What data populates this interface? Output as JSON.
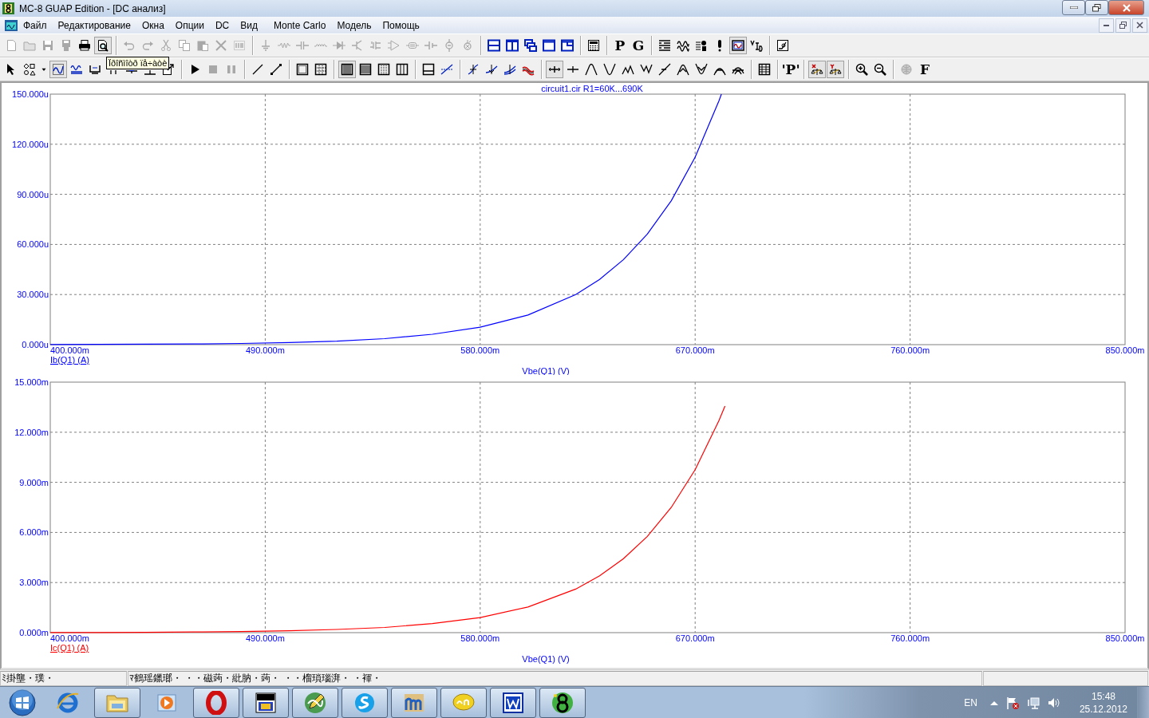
{
  "window": {
    "title": "MC-8 GUAP Edition - [DC анализ]"
  },
  "menu": [
    "Файл",
    "Редактирование",
    "Окна",
    "Опции",
    "DC",
    "Вид",
    "Monte Carlo",
    "Модель",
    "Помощь"
  ],
  "toolbars": [
    {
      "items": [
        {
          "kind": "icon",
          "disabled": true,
          "pressed": false
        },
        {
          "kind": "icon",
          "disabled": true,
          "pressed": false
        },
        {
          "kind": "icon",
          "disabled": true,
          "pressed": false
        },
        {
          "kind": "icon",
          "disabled": true,
          "pressed": false
        },
        {
          "kind": "icon",
          "disabled": false,
          "pressed": false
        },
        {
          "kind": "icon",
          "disabled": false,
          "pressed": true
        },
        {
          "kind": "separator"
        },
        {
          "kind": "icon",
          "disabled": true,
          "pressed": false
        },
        {
          "kind": "icon",
          "disabled": true,
          "pressed": false
        },
        {
          "kind": "icon",
          "disabled": true,
          "pressed": false
        },
        {
          "kind": "icon",
          "disabled": true,
          "pressed": false
        },
        {
          "kind": "icon",
          "disabled": true,
          "pressed": false
        },
        {
          "kind": "icon",
          "disabled": true,
          "pressed": false
        },
        {
          "kind": "icon",
          "disabled": true,
          "pressed": false
        },
        {
          "kind": "separator"
        },
        {
          "kind": "icon",
          "disabled": true,
          "pressed": false
        },
        {
          "kind": "icon",
          "disabled": true,
          "pressed": false
        },
        {
          "kind": "icon",
          "disabled": true,
          "pressed": false
        },
        {
          "kind": "icon",
          "disabled": true,
          "pressed": false
        },
        {
          "kind": "icon",
          "disabled": true,
          "pressed": false
        },
        {
          "kind": "icon",
          "disabled": true,
          "pressed": false
        },
        {
          "kind": "icon",
          "disabled": true,
          "pressed": false
        },
        {
          "kind": "icon",
          "disabled": true,
          "pressed": false
        },
        {
          "kind": "icon",
          "disabled": true,
          "pressed": false
        },
        {
          "kind": "icon",
          "disabled": true,
          "pressed": false
        },
        {
          "kind": "icon",
          "disabled": true,
          "pressed": false
        },
        {
          "kind": "icon",
          "disabled": true,
          "pressed": false
        },
        {
          "kind": "separator"
        },
        {
          "kind": "icon",
          "disabled": false,
          "pressed": false
        },
        {
          "kind": "icon",
          "disabled": false,
          "pressed": false
        },
        {
          "kind": "icon",
          "disabled": false,
          "pressed": false
        },
        {
          "kind": "icon",
          "disabled": false,
          "pressed": false
        },
        {
          "kind": "icon",
          "disabled": false,
          "pressed": false
        },
        {
          "kind": "separator"
        },
        {
          "kind": "icon",
          "disabled": false,
          "pressed": false
        },
        {
          "kind": "separator"
        },
        {
          "kind": "text",
          "label": "P"
        },
        {
          "kind": "text",
          "label": "G"
        },
        {
          "kind": "separator"
        },
        {
          "kind": "icon",
          "disabled": false,
          "pressed": false
        },
        {
          "kind": "icon",
          "disabled": false,
          "pressed": false
        },
        {
          "kind": "icon",
          "disabled": false,
          "pressed": false
        },
        {
          "kind": "icon",
          "disabled": false,
          "pressed": false
        },
        {
          "kind": "icon",
          "disabled": false,
          "pressed": true
        },
        {
          "kind": "icon",
          "disabled": false,
          "pressed": false
        },
        {
          "kind": "separator"
        },
        {
          "kind": "icon",
          "disabled": false,
          "pressed": false
        }
      ]
    },
    {
      "items": [
        {
          "kind": "icon",
          "disabled": false,
          "pressed": false
        },
        {
          "kind": "icon",
          "disabled": false,
          "pressed": false
        },
        {
          "kind": "icon",
          "disabled": false,
          "pressed": false
        },
        {
          "kind": "icon",
          "disabled": false,
          "pressed": true
        },
        {
          "kind": "icon",
          "disabled": false,
          "pressed": false
        },
        {
          "kind": "icon",
          "disabled": false,
          "pressed": false
        },
        {
          "kind": "icon",
          "disabled": false,
          "pressed": false
        },
        {
          "kind": "icon",
          "disabled": false,
          "pressed": false
        },
        {
          "kind": "icon",
          "disabled": false,
          "pressed": false
        },
        {
          "kind": "icon",
          "disabled": false,
          "pressed": false
        },
        {
          "kind": "separator"
        },
        {
          "kind": "icon",
          "disabled": false,
          "pressed": false
        },
        {
          "kind": "icon",
          "disabled": true,
          "pressed": false
        },
        {
          "kind": "icon",
          "disabled": true,
          "pressed": false
        },
        {
          "kind": "separator"
        },
        {
          "kind": "icon",
          "disabled": false,
          "pressed": false
        },
        {
          "kind": "icon",
          "disabled": false,
          "pressed": false
        },
        {
          "kind": "separator"
        },
        {
          "kind": "icon",
          "disabled": false,
          "pressed": false
        },
        {
          "kind": "icon",
          "disabled": false,
          "pressed": false
        },
        {
          "kind": "separator"
        },
        {
          "kind": "icon",
          "disabled": false,
          "pressed": true
        },
        {
          "kind": "icon",
          "disabled": false,
          "pressed": false
        },
        {
          "kind": "icon",
          "disabled": false,
          "pressed": false
        },
        {
          "kind": "icon",
          "disabled": false,
          "pressed": false
        },
        {
          "kind": "separator"
        },
        {
          "kind": "icon",
          "disabled": false,
          "pressed": false
        },
        {
          "kind": "icon",
          "disabled": false,
          "pressed": false
        },
        {
          "kind": "separator"
        },
        {
          "kind": "icon",
          "disabled": false,
          "pressed": false
        },
        {
          "kind": "icon",
          "disabled": false,
          "pressed": false
        },
        {
          "kind": "icon",
          "disabled": false,
          "pressed": false
        },
        {
          "kind": "icon",
          "disabled": false,
          "pressed": false
        },
        {
          "kind": "separator"
        },
        {
          "kind": "icon",
          "disabled": false,
          "pressed": true
        },
        {
          "kind": "icon",
          "disabled": false,
          "pressed": false
        },
        {
          "kind": "icon",
          "disabled": false,
          "pressed": false
        },
        {
          "kind": "icon",
          "disabled": false,
          "pressed": false
        },
        {
          "kind": "icon",
          "disabled": false,
          "pressed": false
        },
        {
          "kind": "icon",
          "disabled": false,
          "pressed": false
        },
        {
          "kind": "icon",
          "disabled": false,
          "pressed": false
        },
        {
          "kind": "icon",
          "disabled": false,
          "pressed": false
        },
        {
          "kind": "icon",
          "disabled": false,
          "pressed": false
        },
        {
          "kind": "icon",
          "disabled": false,
          "pressed": false
        },
        {
          "kind": "icon",
          "disabled": false,
          "pressed": false
        },
        {
          "kind": "separator"
        },
        {
          "kind": "icon",
          "disabled": false,
          "pressed": false
        },
        {
          "kind": "separator"
        },
        {
          "kind": "text",
          "label": "'P'"
        },
        {
          "kind": "separator"
        },
        {
          "kind": "icon",
          "disabled": false,
          "pressed": true
        },
        {
          "kind": "icon",
          "disabled": false,
          "pressed": true
        },
        {
          "kind": "separator"
        },
        {
          "kind": "icon",
          "disabled": false,
          "pressed": false
        },
        {
          "kind": "icon",
          "disabled": false,
          "pressed": false
        },
        {
          "kind": "separator"
        },
        {
          "kind": "icon",
          "disabled": true,
          "pressed": false
        },
        {
          "kind": "text",
          "label": "F"
        }
      ]
    }
  ],
  "tooltip": "Ïðîñìîòð ïå÷àòè",
  "plots": [
    {
      "chart_data": {
        "type": "line",
        "title": "circuit1.cir R1=60K...690K",
        "xlabel": "Vbe(Q1) (V)",
        "grid": true,
        "x": [
          400,
          420,
          440,
          460,
          480,
          500,
          520,
          540,
          560,
          580,
          600,
          620,
          630,
          640,
          650,
          660,
          670,
          680,
          681
        ],
        "series": [
          {
            "name": "Ib(Q1) (A)",
            "color": "#0000ff",
            "values": [
              0.1,
              0.2,
              0.3,
              0.4,
              0.7,
              1.3,
              2.1,
              3.6,
              6.2,
              10.4,
              17.7,
              30,
              39.1,
              50.9,
              66.2,
              86.2,
              112.2,
              146.1,
              150
            ]
          }
        ],
        "xlim": [
          400,
          850
        ],
        "ylim": [
          0,
          150
        ],
        "xticks": [
          {
            "value": 400,
            "label": "400.000m"
          },
          {
            "value": 490,
            "label": "490.000m"
          },
          {
            "value": 580,
            "label": "580.000m"
          },
          {
            "value": 670,
            "label": "670.000m"
          },
          {
            "value": 760,
            "label": "760.000m"
          },
          {
            "value": 850,
            "label": "850.000m"
          }
        ],
        "yticks": [
          {
            "value": 0,
            "label": "0.000u"
          },
          {
            "value": 30,
            "label": "30.000u"
          },
          {
            "value": 60,
            "label": "60.000u"
          },
          {
            "value": 90,
            "label": "90.000u"
          },
          {
            "value": 120,
            "label": "120.000u"
          },
          {
            "value": 150,
            "label": "150.000u"
          }
        ]
      }
    },
    {
      "chart_data": {
        "type": "line",
        "xlabel": "Vbe(Q1) (V)",
        "grid": true,
        "x": [
          400,
          420,
          440,
          460,
          480,
          500,
          520,
          540,
          560,
          580,
          600,
          620,
          630,
          640,
          650,
          660,
          670,
          680,
          682.5
        ],
        "series": [
          {
            "name": "Ic(Q1) (A)",
            "color": "#ff0000",
            "values": [
              0.01,
              0.01,
              0.02,
              0.04,
              0.06,
              0.11,
              0.19,
              0.31,
              0.54,
              0.9,
              1.54,
              2.61,
              3.4,
              4.43,
              5.76,
              7.5,
              9.76,
              12.71,
              13.57
            ]
          }
        ],
        "xlim": [
          400,
          850
        ],
        "ylim": [
          0,
          15
        ],
        "xticks": [
          {
            "value": 400,
            "label": "400.000m"
          },
          {
            "value": 490,
            "label": "490.000m"
          },
          {
            "value": 580,
            "label": "580.000m"
          },
          {
            "value": 670,
            "label": "670.000m"
          },
          {
            "value": 760,
            "label": "760.000m"
          },
          {
            "value": 850,
            "label": "850.000m"
          }
        ],
        "yticks": [
          {
            "value": 0,
            "label": "0.000m"
          },
          {
            "value": 3,
            "label": "3.000m"
          },
          {
            "value": 6,
            "label": "6.000m"
          },
          {
            "value": 9,
            "label": "9.000m"
          },
          {
            "value": 12,
            "label": "12.000m"
          },
          {
            "value": 15,
            "label": "15.000m"
          }
        ]
      }
    }
  ],
  "status_bar": [
    "ﾐ掛壟・璞・",
    "ﾏ鶴瑶鑞瑯・ ・・磁蒟・紕肭・蒟・ ・・榴瑣瑙湃・ ・褌・"
  ],
  "taskbar": {
    "apps": [
      {
        "running": false
      },
      {
        "running": true
      },
      {
        "running": false
      },
      {
        "running": true
      },
      {
        "running": true
      },
      {
        "running": true
      },
      {
        "running": true
      },
      {
        "running": true
      },
      {
        "running": true
      },
      {
        "running": true
      },
      {
        "running": true
      }
    ],
    "language": "EN",
    "time": "15:48",
    "date": "25.12.2012"
  }
}
